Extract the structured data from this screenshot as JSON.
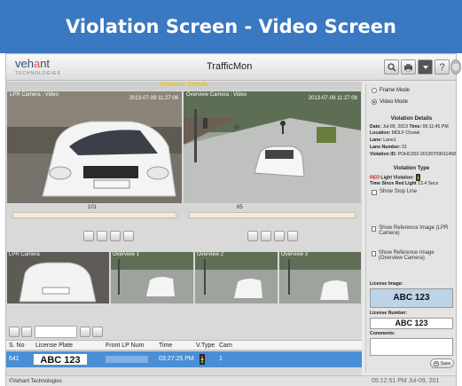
{
  "banner": {
    "title": "Violation Screen - Video Screen"
  },
  "app": {
    "title": "TrafficMon",
    "logo_main": "veh",
    "logo_accent": "a",
    "logo_end": "nt",
    "logo_sub": "TECHNOLOGIES",
    "toolbar_icons": [
      "search-icon",
      "print-icon",
      "dropdown-icon",
      "help-icon",
      "close-icon"
    ],
    "toolbar_help": "?",
    "toolbar_close": "⊗"
  },
  "video": {
    "section_title": "Violation Details",
    "lpr_label": "LPR Camera : Video",
    "lpr_timestamp": "2013-07-09 11:27:06",
    "overview_label": "Overview Camera : Video",
    "overview_timestamp": "2013-07-09 11:27:08",
    "lpr_slider_value": "101",
    "overview_slider_value": "65",
    "thumbs": [
      "LPR Camera",
      "Overview 1",
      "Overview 2",
      "Overview 3"
    ]
  },
  "table": {
    "headers": [
      "S. No",
      "License Plate",
      "Front LP Num",
      "Time",
      "V.Type",
      "Cam"
    ],
    "rows": [
      {
        "sno": "641",
        "plate": "ABC 123",
        "front": "",
        "time": "03:27:25 PM",
        "cam": "1"
      }
    ]
  },
  "status": {
    "left": "©Vehant Technologies",
    "right": "05:12:51 PM   Jul-09, 201"
  },
  "side": {
    "modes": [
      "Frame Mode",
      "Video Mode"
    ],
    "selected_mode": "Video Mode",
    "details_title": "Violation Details",
    "details": [
      {
        "label": "Date:",
        "value": "Jul-09, 2013 ",
        "label2": "Time:",
        "value2": "05:11:45 PM"
      },
      {
        "label": "Location:",
        "value": "MDLF Chowk"
      },
      {
        "label": "Lane:",
        "value": "Lane1"
      },
      {
        "label": "Lane Number:",
        "value": "01"
      },
      {
        "label": "Violation ID:",
        "value": "POHC002-20130709011458"
      }
    ],
    "violation_type_title": "Violation Type",
    "red_light_prefix": "RED",
    "red_light_label": " Light Violation:",
    "time_since_label": "Time Since Red Light",
    "time_since_value": "13.4 Secs",
    "show_stop_line": "Show Stop Line",
    "ref_lpr": "Show Reference Image (LPR Camera)",
    "ref_overview": "Show Reference Image (Overview Camera)",
    "license_image_label": "License Image:",
    "license_image_text": "ABC 123",
    "license_number_label": "License Number:",
    "license_number_value": "ABC 123",
    "comments_label": "Comments:",
    "save_label": "Save"
  }
}
